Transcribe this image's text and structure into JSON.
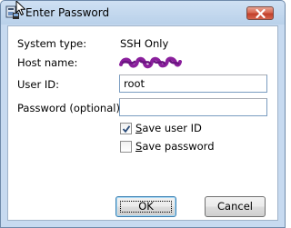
{
  "window": {
    "title": "Enter Password"
  },
  "fields": {
    "system_type_label": "System type:",
    "system_type_value": "SSH Only",
    "host_name_label": "Host name:",
    "user_id_label": "User ID:",
    "user_id_value": "root",
    "password_label": "Password (optional):",
    "password_value": ""
  },
  "options": {
    "save_user_id_label": "Save user ID",
    "save_user_id_checked": true,
    "save_password_label": "Save password",
    "save_password_checked": false
  },
  "buttons": {
    "ok_label": "OK",
    "cancel_label": "Cancel"
  },
  "colors": {
    "title_bar": "#b9d1ea",
    "close_button": "#c2402a",
    "redaction_scribble": "#8a1f9c",
    "default_button_border": "#3c7fb1"
  },
  "icons": {
    "app": "key-window-icon",
    "close": "close-icon",
    "cursor": "mouse-pointer-icon",
    "checkmark": "checkmark-icon"
  }
}
